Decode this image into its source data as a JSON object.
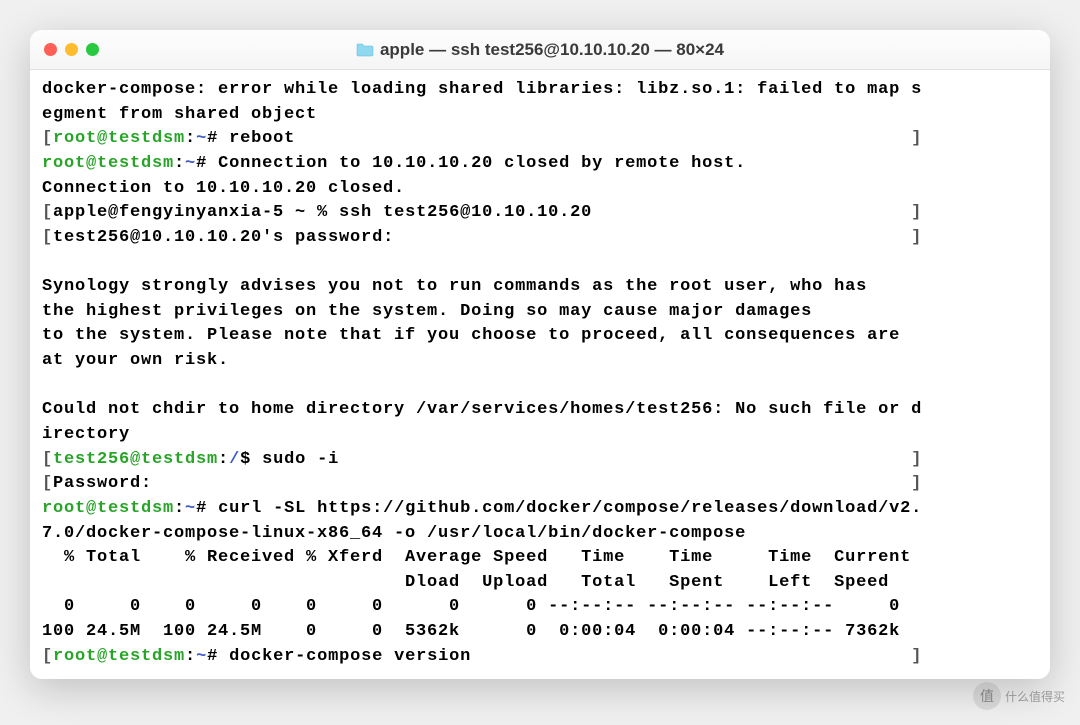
{
  "window": {
    "title": "apple — ssh test256@10.10.10.20 — 80×24"
  },
  "terminal": {
    "lines": [
      {
        "type": "plain",
        "text": "docker-compose: error while loading shared libraries: libz.so.1: failed to map s"
      },
      {
        "type": "plain",
        "text": "egment from shared object"
      },
      {
        "type": "prompt-root",
        "bracket_open": "[",
        "user_host": "root@testdsm",
        "colon": ":",
        "path": "~",
        "hash": "#",
        "cmd": " reboot",
        "bracket_close": "]"
      },
      {
        "type": "prompt-root-inline",
        "user_host": "root@testdsm",
        "colon": ":",
        "path": "~",
        "hash": "#",
        "cmd": " Connection to 10.10.10.20 closed by remote host."
      },
      {
        "type": "plain",
        "text": "Connection to 10.10.10.20 closed."
      },
      {
        "type": "bracketed",
        "bracket_open": "[",
        "text": "apple@fengyinyanxia-5 ~ % ssh test256@10.10.10.20",
        "bracket_close": "]"
      },
      {
        "type": "bracketed",
        "bracket_open": "[",
        "text": "test256@10.10.10.20's password:",
        "bracket_close": "]"
      },
      {
        "type": "blank"
      },
      {
        "type": "plain",
        "text": "Synology strongly advises you not to run commands as the root user, who has"
      },
      {
        "type": "plain",
        "text": "the highest privileges on the system. Doing so may cause major damages"
      },
      {
        "type": "plain",
        "text": "to the system. Please note that if you choose to proceed, all consequences are"
      },
      {
        "type": "plain",
        "text": "at your own risk."
      },
      {
        "type": "blank"
      },
      {
        "type": "plain",
        "text": "Could not chdir to home directory /var/services/homes/test256: No such file or d"
      },
      {
        "type": "plain",
        "text": "irectory"
      },
      {
        "type": "prompt-user",
        "bracket_open": "[",
        "user_host": "test256@testdsm",
        "colon": ":",
        "path": "/",
        "dollar": "$",
        "cmd": " sudo -i",
        "bracket_close": "]"
      },
      {
        "type": "bracketed",
        "bracket_open": "[",
        "text": "Password:",
        "bracket_close": "]"
      },
      {
        "type": "prompt-root-inline",
        "user_host": "root@testdsm",
        "colon": ":",
        "path": "~",
        "hash": "#",
        "cmd": " curl -SL https://github.com/docker/compose/releases/download/v2."
      },
      {
        "type": "plain",
        "text": "7.0/docker-compose-linux-x86_64 -o /usr/local/bin/docker-compose"
      },
      {
        "type": "plain",
        "text": "  % Total    % Received % Xferd  Average Speed   Time    Time     Time  Current"
      },
      {
        "type": "plain",
        "text": "                                 Dload  Upload   Total   Spent    Left  Speed"
      },
      {
        "type": "plain",
        "text": "  0     0    0     0    0     0      0      0 --:--:-- --:--:-- --:--:--     0"
      },
      {
        "type": "plain",
        "text": "100 24.5M  100 24.5M    0     0  5362k      0  0:00:04  0:00:04 --:--:-- 7362k"
      },
      {
        "type": "prompt-root",
        "bracket_open": "[",
        "user_host": "root@testdsm",
        "colon": ":",
        "path": "~",
        "hash": "#",
        "cmd": " docker-compose version",
        "bracket_close": "]"
      }
    ]
  },
  "watermark": {
    "icon": "值",
    "text": "什么值得买"
  }
}
